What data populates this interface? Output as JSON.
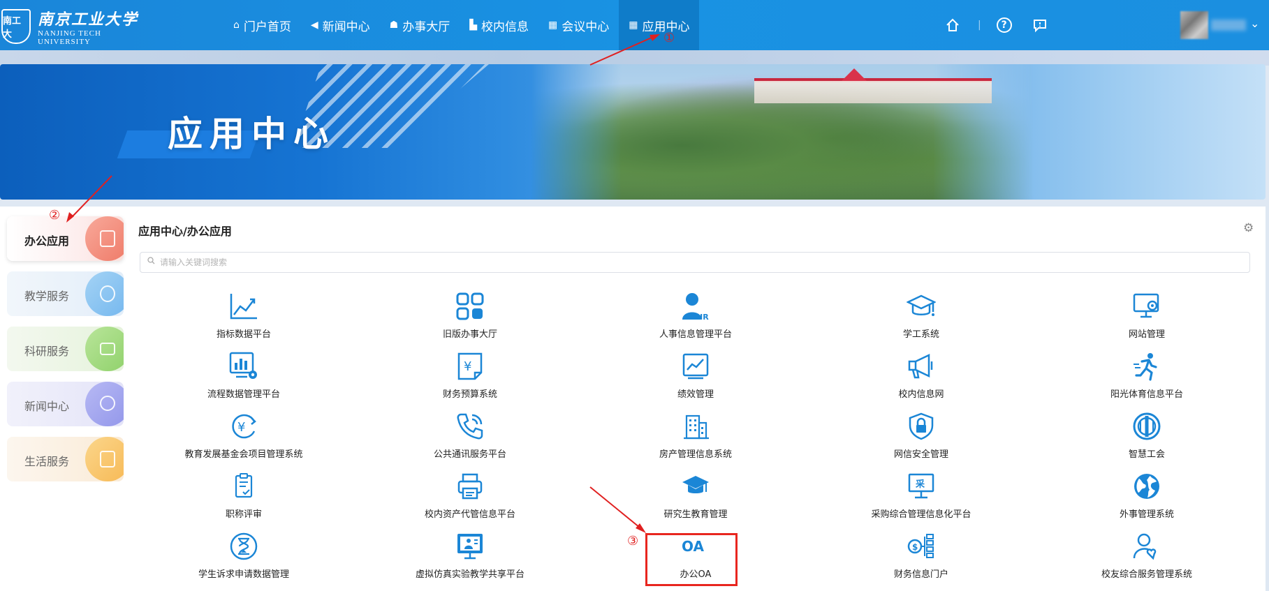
{
  "header": {
    "logo_seal": "南工大",
    "logo_cn": "南京工业大学",
    "logo_en_1": "NANJING TECH",
    "logo_en_2": "UNIVERSITY",
    "nav": [
      {
        "label": "门户首页",
        "icon": "home-outline-icon"
      },
      {
        "label": "新闻中心",
        "icon": "megaphone-icon"
      },
      {
        "label": "办事大厅",
        "icon": "hat-icon"
      },
      {
        "label": "校内信息",
        "icon": "building-icon"
      },
      {
        "label": "会议中心",
        "icon": "table-icon"
      },
      {
        "label": "应用中心",
        "icon": "grid-icon",
        "active": true
      }
    ],
    "tools": [
      "home-icon",
      "help-icon",
      "message-icon"
    ]
  },
  "banner": {
    "title": "应用中心"
  },
  "sidebar": {
    "items": [
      {
        "label": "办公应用",
        "active": true
      },
      {
        "label": "教学服务"
      },
      {
        "label": "科研服务"
      },
      {
        "label": "新闻中心"
      },
      {
        "label": "生活服务"
      }
    ]
  },
  "main": {
    "breadcrumb": "应用中心/办公应用",
    "search_placeholder": "请输入关键词搜索",
    "apps": [
      {
        "label": "指标数据平台",
        "icon": "line-chart-icon"
      },
      {
        "label": "旧版办事大厅",
        "icon": "apps-grid-icon"
      },
      {
        "label": "人事信息管理平台",
        "icon": "hr-person-icon"
      },
      {
        "label": "学工系统",
        "icon": "graduation-cap-icon"
      },
      {
        "label": "网站管理",
        "icon": "monitor-gear-icon"
      },
      {
        "label": "流程数据管理平台",
        "icon": "bar-chart-gear-icon"
      },
      {
        "label": "财务预算系统",
        "icon": "yen-document-icon"
      },
      {
        "label": "绩效管理",
        "icon": "trend-board-icon"
      },
      {
        "label": "校内信息网",
        "icon": "megaphone-icon"
      },
      {
        "label": "阳光体育信息平台",
        "icon": "runner-icon"
      },
      {
        "label": "教育发展基金会项目管理系统",
        "icon": "yen-cycle-icon"
      },
      {
        "label": "公共通讯服务平台",
        "icon": "phone-icon"
      },
      {
        "label": "房产管理信息系统",
        "icon": "buildings-icon"
      },
      {
        "label": "网信安全管理",
        "icon": "shield-lock-icon"
      },
      {
        "label": "智慧工会",
        "icon": "union-emblem-icon"
      },
      {
        "label": "职称评审",
        "icon": "clipboard-check-icon"
      },
      {
        "label": "校内资产代管信息平台",
        "icon": "printer-icon"
      },
      {
        "label": "研究生教育管理",
        "icon": "mortarboard-icon"
      },
      {
        "label": "采购综合管理信息化平台",
        "icon": "procurement-screen-icon"
      },
      {
        "label": "外事管理系统",
        "icon": "globe-icon"
      },
      {
        "label": "学生诉求申请数据管理",
        "icon": "hourglass-icon"
      },
      {
        "label": "虚拟仿真实验教学共享平台",
        "icon": "presentation-screen-icon"
      },
      {
        "label": "办公OA",
        "icon": "oa-icon"
      },
      {
        "label": "财务信息门户",
        "icon": "money-network-icon"
      },
      {
        "label": "校友综合服务管理系统",
        "icon": "person-heart-icon"
      }
    ]
  },
  "annotations": {
    "step1": "①",
    "step2": "②",
    "step3": "③",
    "color": "#e02020"
  },
  "colors": {
    "header_bg": "#1a86d9",
    "nav_active": "#0f7cc9",
    "icon_blue": "#1b86d6"
  }
}
